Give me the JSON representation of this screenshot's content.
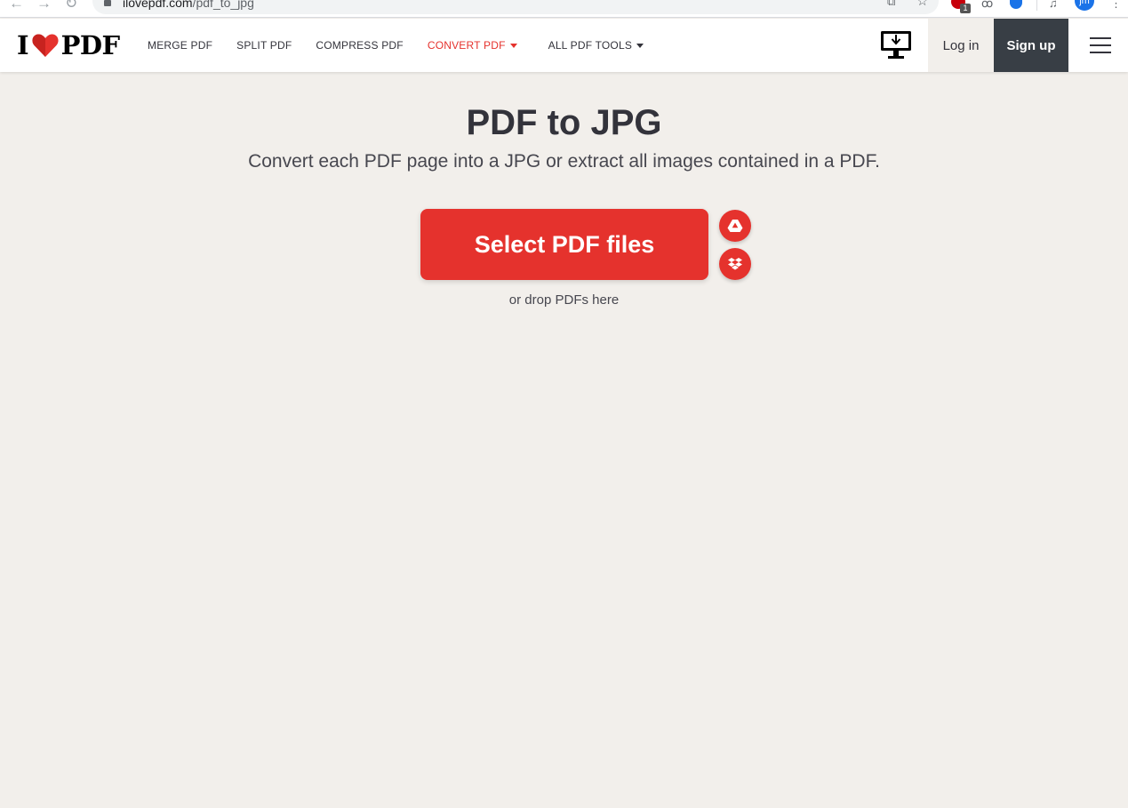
{
  "browser": {
    "url_host": "ilovepdf.com",
    "url_path": "/pdf_to_jpg",
    "adblock_badge": "1",
    "profile_initials": "jm"
  },
  "header": {
    "logo": {
      "i": "I",
      "pdf": "PDF",
      "heart_color": "#e5322d"
    },
    "menu": [
      {
        "label": "MERGE PDF"
      },
      {
        "label": "SPLIT PDF"
      },
      {
        "label": "COMPRESS PDF"
      },
      {
        "label": "CONVERT PDF"
      },
      {
        "label": "ALL PDF TOOLS"
      }
    ],
    "desktop_icon": "desktop-download-icon",
    "login_label": "Log in",
    "signup_label": "Sign up",
    "menu_icon": "hamburger-menu-icon"
  },
  "main": {
    "title": "PDF to JPG",
    "subtitle": "Convert each PDF page into a JPG or extract all images contained in a PDF.",
    "select_button": "Select PDF files",
    "drop_hint": "or drop PDFs here",
    "cloud_icons": [
      "google-drive-icon",
      "dropbox-icon"
    ]
  },
  "colors": {
    "brand_red": "#e5322d",
    "page_bg": "#f2efeb",
    "header_bg": "#ffffff",
    "signup_bg": "#383e45",
    "text_dark": "#33333b"
  }
}
